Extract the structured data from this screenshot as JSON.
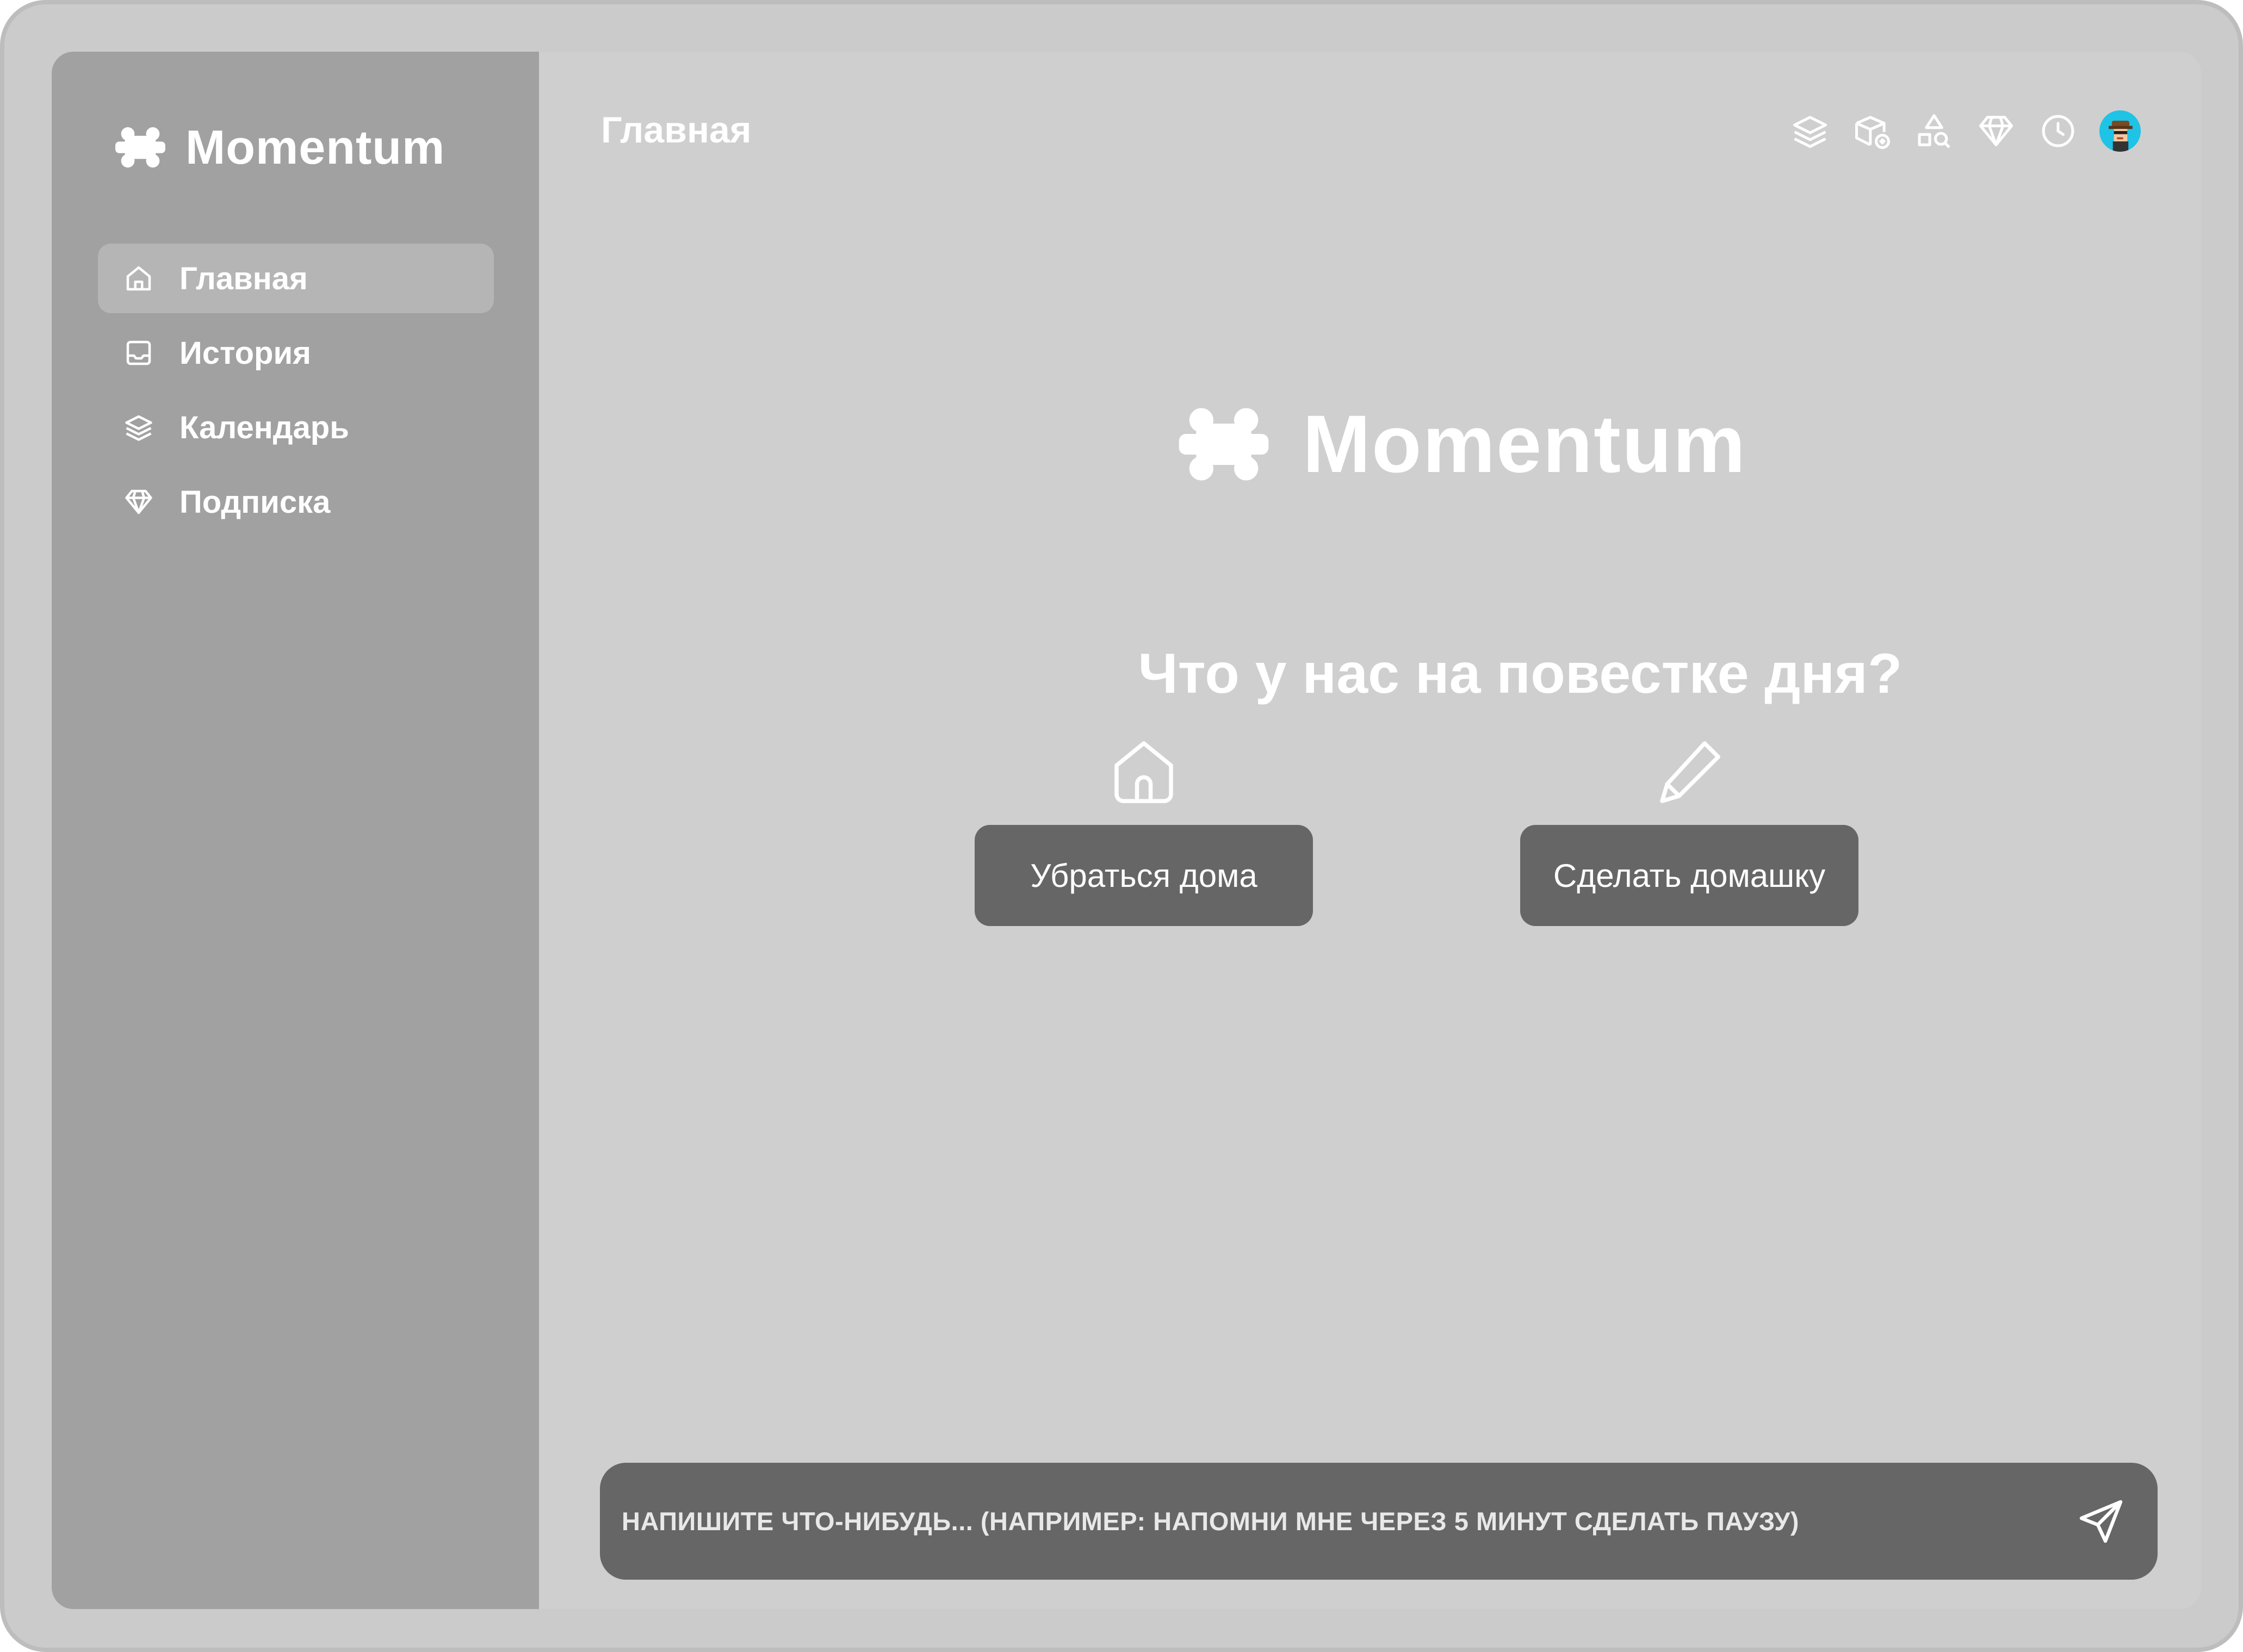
{
  "app": {
    "brand_name": "Momentum"
  },
  "sidebar": {
    "items": [
      {
        "label": "Главная",
        "icon": "home-icon",
        "active": true
      },
      {
        "label": "История",
        "icon": "inbox-icon",
        "active": false
      },
      {
        "label": "Календарь",
        "icon": "layers-icon",
        "active": false
      },
      {
        "label": "Подписка",
        "icon": "diamond-icon",
        "active": false
      }
    ]
  },
  "header": {
    "title": "Главная",
    "icons": [
      "layers-icon",
      "box-add-icon",
      "shapes-search-icon",
      "diamond-icon",
      "clock-icon",
      "avatar"
    ]
  },
  "main": {
    "hero_brand": "Momentum",
    "question": "Что у нас на повестке дня?",
    "actions": [
      {
        "label": "Убраться дома",
        "icon": "home-icon"
      },
      {
        "label": "Сделать домашку",
        "icon": "pencil-icon"
      }
    ]
  },
  "composer": {
    "placeholder": "НАПИШИТЕ ЧТО-НИБУДЬ... (НАПРИМЕР: НАПОМНИ МНЕ ЧЕРЕЗ 5 МИНУТ СДЕЛАТЬ ПАУЗУ)",
    "send_icon": "send-icon"
  },
  "colors": {
    "frame": "#cbcbcb",
    "sidebar": "#a1a1a1",
    "sidebar_active": "#b5b5b5",
    "content": "#cfcfcf",
    "button": "#666666",
    "text": "#ffffff",
    "avatar_bg": "#1ec3e6"
  }
}
